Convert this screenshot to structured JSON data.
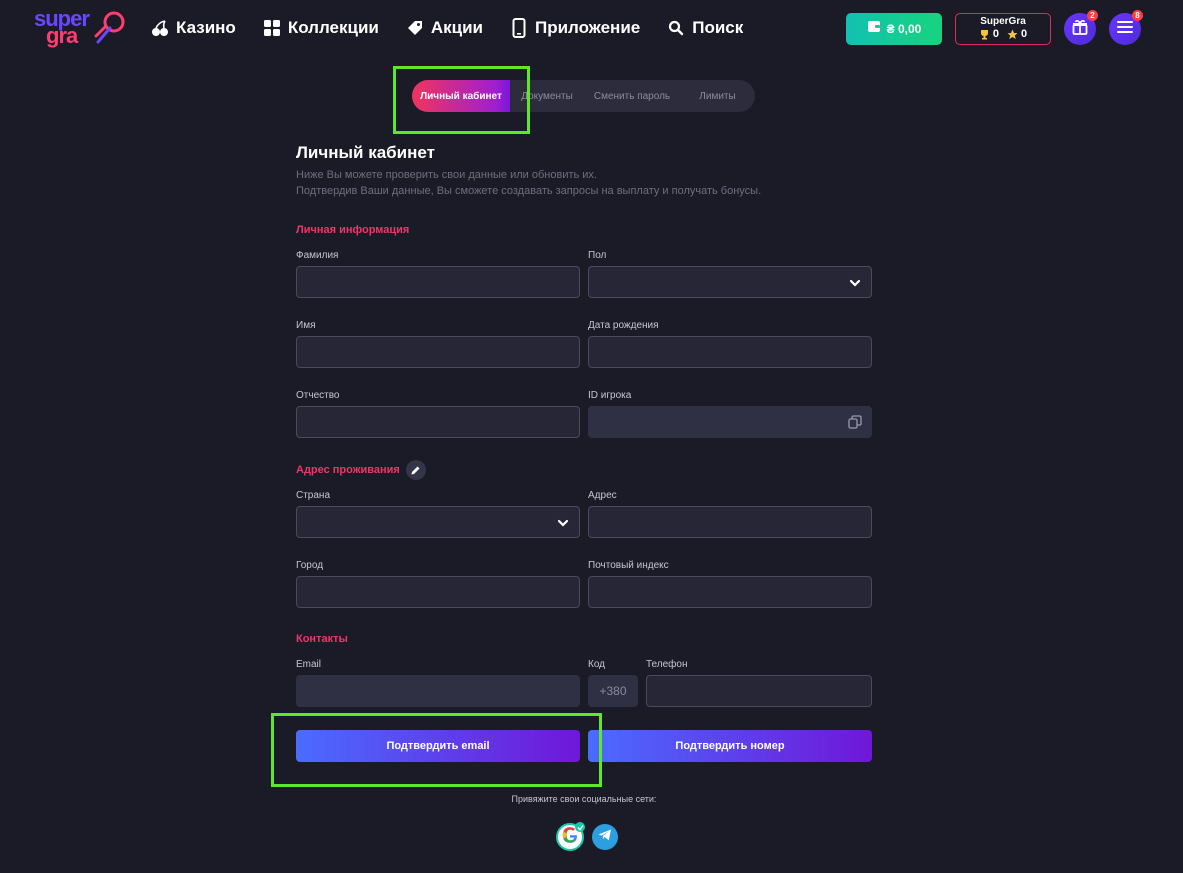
{
  "brand": {
    "line1": "super",
    "line2": "gra"
  },
  "nav": [
    {
      "label": "Казино",
      "icon": "cherry-icon"
    },
    {
      "label": "Коллекции",
      "icon": "grid-icon"
    },
    {
      "label": "Акции",
      "icon": "tag-icon"
    },
    {
      "label": "Приложение",
      "icon": "phone-icon"
    },
    {
      "label": "Поиск",
      "icon": "search-icon"
    }
  ],
  "header": {
    "balance": "₴ 0,00",
    "club": {
      "name": "SuperGra",
      "trophies": "0",
      "stars": "0"
    },
    "gifts_badge": "2",
    "menu_badge": "8"
  },
  "tabs": [
    {
      "label": "Личный кабинет",
      "active": true
    },
    {
      "label": "Документы"
    },
    {
      "label": "Сменить пароль"
    },
    {
      "label": "Лимиты"
    }
  ],
  "page": {
    "title": "Личный кабинет",
    "desc1": "Ниже Вы можете проверить свои данные или обновить их.",
    "desc2": "Подтвердив Ваши данные, Вы сможете создавать запросы на выплату и получать бонусы."
  },
  "personal": {
    "heading": "Личная информация",
    "surname_label": "Фамилия",
    "surname_value": "",
    "gender_label": "Пол",
    "gender_value": "",
    "name_label": "Имя",
    "name_value": "",
    "birth_label": "Дата рождения",
    "birth_value": "",
    "patronymic_label": "Отчество",
    "patronymic_value": "",
    "player_id_label": "ID игрока",
    "player_id_value": ""
  },
  "address": {
    "heading": "Адрес проживания",
    "country_label": "Страна",
    "country_value": "",
    "address_label": "Адрес",
    "address_value": "",
    "city_label": "Город",
    "city_value": "",
    "zip_label": "Почтовый индекс",
    "zip_value": ""
  },
  "contacts": {
    "heading": "Контакты",
    "email_label": "Email",
    "email_value": "",
    "code_label": "Код",
    "code_value": "+380",
    "phone_label": "Телефон",
    "phone_value": "",
    "verify_email": "Подтвердить email",
    "verify_phone": "Подтвердить номер"
  },
  "social": {
    "label": "Привяжите свои социальные сети:",
    "networks": [
      "google-icon",
      "telegram-icon"
    ]
  },
  "colors": {
    "background": "#1b1b27",
    "accent": "#f0356b",
    "balance": "#18d37e",
    "highlight": "#5ee82a"
  }
}
